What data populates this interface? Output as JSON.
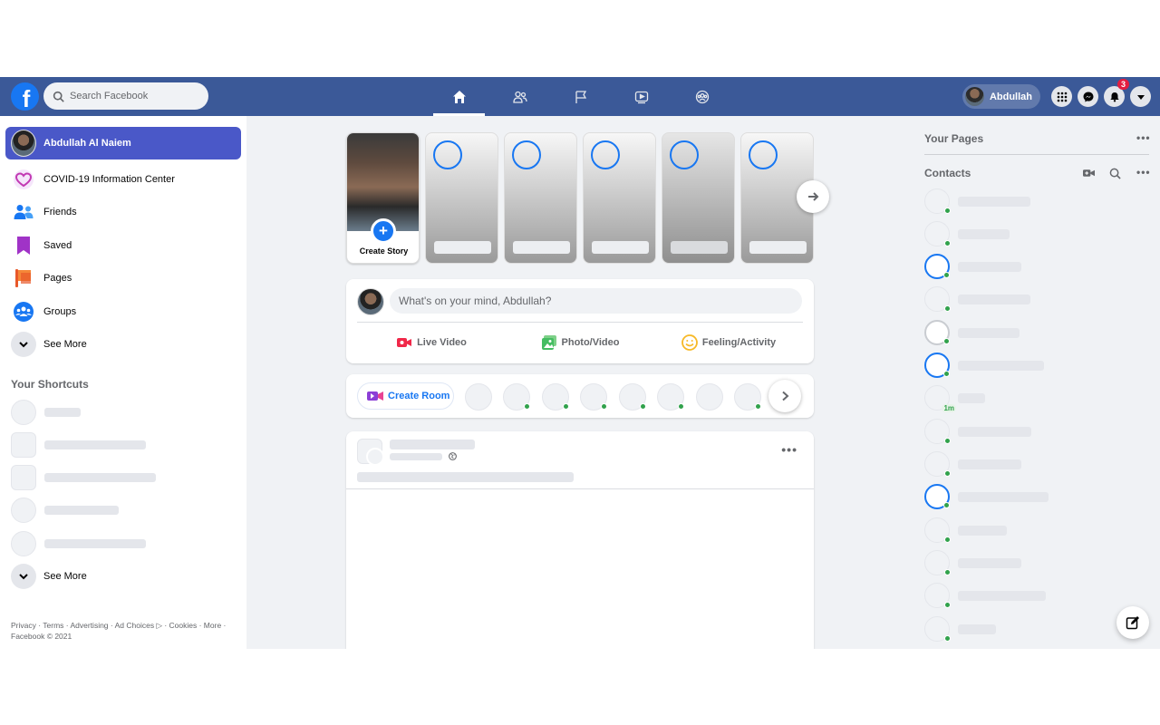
{
  "topbar": {
    "logo_letter": "f",
    "search_placeholder": "Search Facebook",
    "tabs": [
      "home-icon",
      "friends-icon",
      "pages-flag-icon",
      "watch-icon",
      "groups-icon"
    ],
    "profile_name": "Abdullah",
    "notification_count": "3",
    "brand_color": "#3b5998"
  },
  "sidebar": {
    "profile_name": "Abdullah Al Naiem",
    "items": [
      {
        "label": "COVID-19 Information Center",
        "icon": "covid-heart-icon"
      },
      {
        "label": "Friends",
        "icon": "friends-icon"
      },
      {
        "label": "Saved",
        "icon": "bookmark-icon"
      },
      {
        "label": "Pages",
        "icon": "flag-icon"
      },
      {
        "label": "Groups",
        "icon": "groups-icon"
      },
      {
        "label": "See More",
        "icon": "chevron-down-icon"
      }
    ],
    "shortcuts_title": "Your Shortcuts",
    "shortcuts_see_more": "See More",
    "footer": "Privacy · Terms · Advertising · Ad Choices ▷ · Cookies · More · Facebook © 2021"
  },
  "stories": {
    "create_label": "Create Story",
    "plus_glyph": "+"
  },
  "composer": {
    "prompt": "What's on your mind, Abdullah?",
    "live_label": "Live Video",
    "photo_label": "Photo/Video",
    "feeling_label": "Feeling/Activity"
  },
  "rooms": {
    "create_label": "Create Room"
  },
  "post": {
    "menu_glyph": "•••"
  },
  "right": {
    "pages_title": "Your Pages",
    "contacts_title": "Contacts",
    "menu_glyph": "•••",
    "recent_badge": "1m"
  }
}
